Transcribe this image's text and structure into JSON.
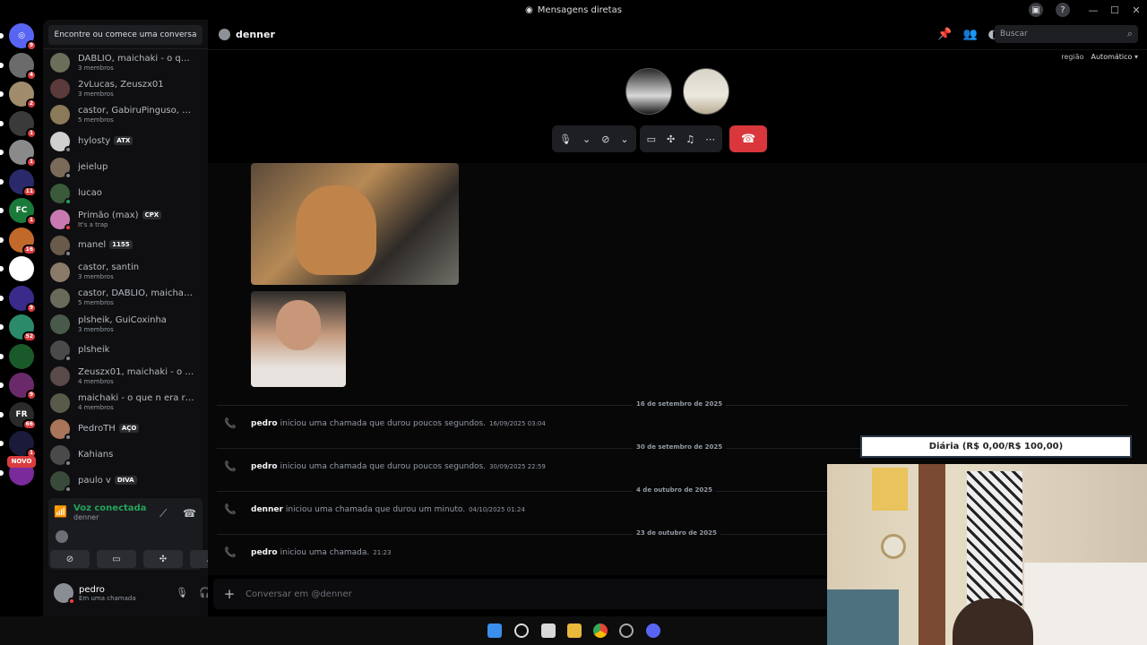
{
  "window": {
    "title": "Mensagens diretas"
  },
  "servers": [
    {
      "badge": "9",
      "color": "#5865f2",
      "glyph": "◎"
    },
    {
      "badge": "4",
      "color": "#6b6b6b",
      "glyph": ""
    },
    {
      "badge": "2",
      "color": "#a08c6c",
      "glyph": ""
    },
    {
      "badge": "1",
      "color": "#3a3a3a",
      "glyph": ""
    },
    {
      "badge": "1",
      "color": "#8a8a8a",
      "glyph": ""
    },
    {
      "badge": "11",
      "color": "#2a2a6a",
      "glyph": ""
    },
    {
      "badge": "1",
      "color": "#1a7a3a",
      "glyph": "FC"
    },
    {
      "badge": "16",
      "color": "#c0692b",
      "glyph": ""
    },
    {
      "badge": "",
      "color": "#ffffff",
      "glyph": ""
    },
    {
      "badge": "9",
      "color": "#3a2a8a",
      "glyph": ""
    },
    {
      "badge": "52",
      "color": "#2a8a6a",
      "glyph": ""
    },
    {
      "badge": "",
      "color": "#1a5a2a",
      "glyph": ""
    },
    {
      "badge": "9",
      "color": "#6a2a6a",
      "glyph": ""
    },
    {
      "badge": "66",
      "color": "#2a2a2a",
      "glyph": "FR"
    },
    {
      "badge": "1",
      "color": "#1a1a3a",
      "glyph": ""
    },
    {
      "badge": "",
      "color": "#7a2a9a",
      "glyph": ""
    }
  ],
  "novo_label": "NOVO",
  "dm_search": "Encontre ou comece uma conversa",
  "dms": [
    {
      "name": "DABLIO, maichaki - o que ...",
      "sub": "3 membros",
      "tag": "",
      "status": ""
    },
    {
      "name": "2vLucas, Zeuszx01",
      "sub": "3 membros",
      "tag": "",
      "status": ""
    },
    {
      "name": "castor, GabiruPinguso, m...",
      "sub": "5 membros",
      "tag": "",
      "status": ""
    },
    {
      "name": "hylosty",
      "sub": "",
      "tag": "ATX",
      "status": "off"
    },
    {
      "name": "jeielup",
      "sub": "",
      "tag": "",
      "status": "off"
    },
    {
      "name": "lucao",
      "sub": "",
      "tag": "",
      "status": "on"
    },
    {
      "name": "Primão (max)",
      "sub": "It's a trap",
      "tag": "CPX",
      "status": "dnd"
    },
    {
      "name": "manel",
      "sub": "",
      "tag": "1155",
      "status": "off"
    },
    {
      "name": "castor, santin",
      "sub": "3 membros",
      "tag": "",
      "status": ""
    },
    {
      "name": "castor, DABLIO, maichaki ...",
      "sub": "5 membros",
      "tag": "",
      "status": ""
    },
    {
      "name": "plsheik, GuiCoxinha",
      "sub": "3 membros",
      "tag": "",
      "status": ""
    },
    {
      "name": "plsheik",
      "sub": "",
      "tag": "",
      "status": "off"
    },
    {
      "name": "Zeuszx01, maichaki - o qu...",
      "sub": "4 membros",
      "tag": "",
      "status": ""
    },
    {
      "name": "maichaki - o que n era rui...",
      "sub": "4 membros",
      "tag": "",
      "status": ""
    },
    {
      "name": "PedroTH",
      "sub": "",
      "tag": "AÇO",
      "status": "off"
    },
    {
      "name": "Kahians",
      "sub": "",
      "tag": "",
      "status": "off"
    },
    {
      "name": "paulo v",
      "sub": "",
      "tag": "DIVA",
      "status": "off"
    }
  ],
  "voice": {
    "status": "Voz conectada",
    "channel": "denner"
  },
  "user": {
    "name": "pedro",
    "status": "Em uma chamada"
  },
  "channel": {
    "name": "denner"
  },
  "search": {
    "placeholder": "Buscar"
  },
  "region": {
    "label": "região",
    "value": "Automático"
  },
  "messages": [
    {
      "date": "16 de setembro de 2025",
      "author": "pedro",
      "text": "iniciou uma chamada que durou poucos segundos.",
      "time": "16/09/2025 03:04"
    },
    {
      "date": "30 de setembro de 2025",
      "author": "pedro",
      "text": "iniciou uma chamada que durou poucos segundos.",
      "time": "30/09/2025 22:59"
    },
    {
      "date": "4 de outubro de 2025",
      "author": "denner",
      "text": "iniciou uma chamada que durou um minuto.",
      "time": "04/10/2025 01:24"
    },
    {
      "date": "23 de outubro de 2025",
      "author": "pedro",
      "text": "iniciou uma chamada.",
      "time": "21:23"
    }
  ],
  "composer": {
    "placeholder": "Conversar em @denner"
  },
  "overlay": {
    "goal": "Diária (R$ 0,00/R$ 100,00)"
  },
  "colors": {
    "accent": "#5865f2",
    "online": "#23a55a",
    "danger": "#da373c"
  }
}
